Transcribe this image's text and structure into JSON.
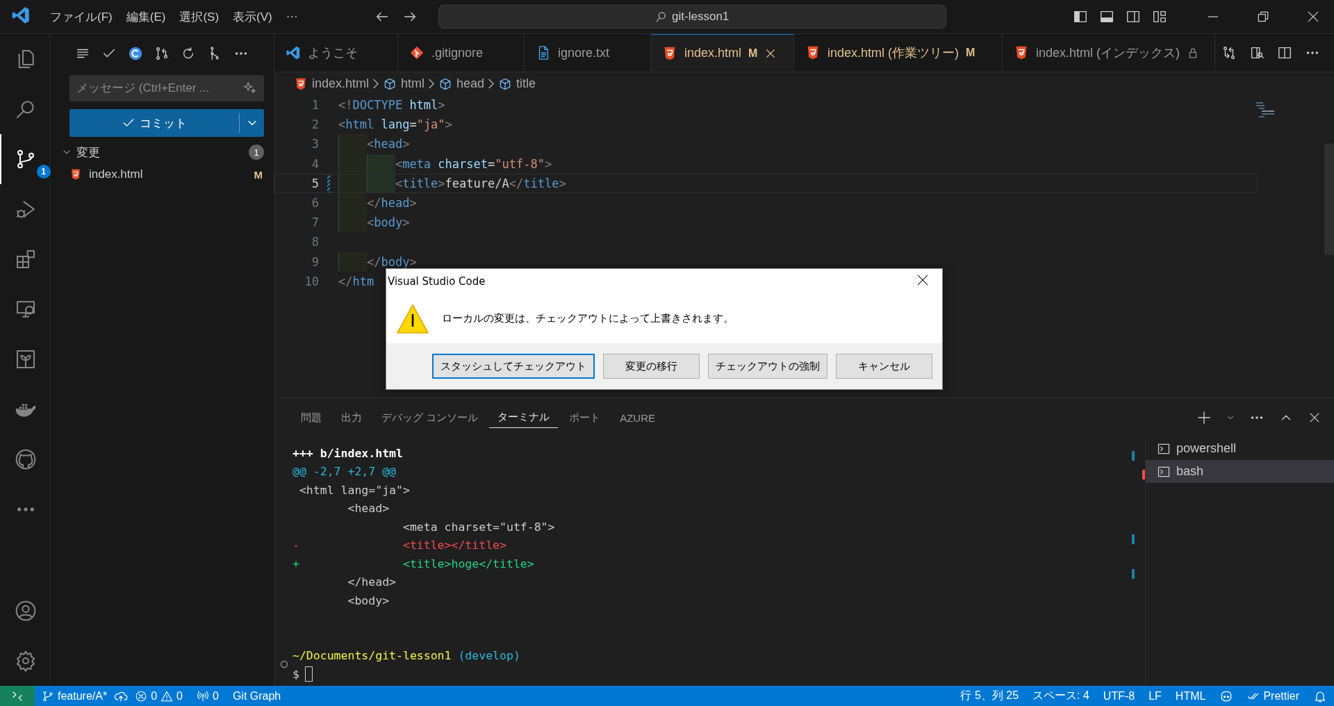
{
  "title_bar": {
    "menus": [
      "ファイル(F)",
      "編集(E)",
      "選択(S)",
      "表示(V)",
      "···"
    ],
    "command_center": "git-lesson1"
  },
  "activity_bar": {
    "items": [
      {
        "selected": false
      },
      {
        "selected": false
      },
      {
        "selected": true,
        "badge": "1"
      },
      {
        "selected": false
      },
      {
        "selected": false
      },
      {
        "selected": false
      },
      {
        "selected": false
      },
      {
        "selected": false
      },
      {
        "selected": false
      },
      {
        "selected": false
      }
    ]
  },
  "sidebar": {
    "message": {
      "placeholder": "メッセージ (Ctrl+Enter ..."
    },
    "commit_button": "コミット",
    "changes": {
      "label": "変更",
      "expanded": true,
      "count": "1",
      "files": [
        {
          "name": "index.html",
          "status": "M"
        }
      ]
    }
  },
  "tabs": [
    {
      "kind": "welcome",
      "label": "ようこそ",
      "selected": false,
      "modified": false
    },
    {
      "kind": "git",
      "label": ".gitignore",
      "selected": false,
      "modified": false
    },
    {
      "kind": "text",
      "label": "ignore.txt",
      "selected": false,
      "modified": false
    },
    {
      "kind": "html",
      "label": "index.html",
      "status": "M",
      "selected": true,
      "modified": true
    },
    {
      "kind": "html",
      "label": "index.html (作業ツリー)",
      "status": "M",
      "selected": false,
      "modified": true
    },
    {
      "kind": "html",
      "label": "index.html (インデックス)",
      "selected": false,
      "modified": false,
      "locked": true
    }
  ],
  "breadcrumbs": [
    {
      "kind": "file",
      "label": "index.html"
    },
    {
      "kind": "element",
      "label": "html"
    },
    {
      "kind": "element",
      "label": "head"
    },
    {
      "kind": "element",
      "label": "title"
    }
  ],
  "editor": {
    "lines": [
      {
        "number": "1",
        "tokens": [
          {
            "kind": "p",
            "text": "<!"
          },
          {
            "kind": "t",
            "text": "DOCTYPE"
          },
          {
            "kind": "a",
            "text": " html"
          },
          {
            "kind": "p",
            "text": ">"
          }
        ]
      },
      {
        "number": "2",
        "tokens": [
          {
            "kind": "p",
            "text": "<"
          },
          {
            "kind": "t",
            "text": "html"
          },
          {
            "kind": "a",
            "text": " lang"
          },
          {
            "kind": "x",
            "text": "="
          },
          {
            "kind": "s",
            "text": "\"ja\""
          },
          {
            "kind": "p",
            "text": ">"
          }
        ]
      },
      {
        "number": "3",
        "tokens": [
          {
            "kind": "p",
            "text": "    <"
          },
          {
            "kind": "t",
            "text": "head"
          },
          {
            "kind": "p",
            "text": ">"
          }
        ]
      },
      {
        "number": "4",
        "tokens": [
          {
            "kind": "p",
            "text": "        <"
          },
          {
            "kind": "t",
            "text": "meta"
          },
          {
            "kind": "a",
            "text": " charset"
          },
          {
            "kind": "x",
            "text": "="
          },
          {
            "kind": "s",
            "text": "\"utf-8\""
          },
          {
            "kind": "p",
            "text": ">"
          }
        ]
      },
      {
        "number": "5",
        "current": true,
        "modified": true,
        "tokens": [
          {
            "kind": "p",
            "text": "        <"
          },
          {
            "kind": "t",
            "text": "title"
          },
          {
            "kind": "p",
            "text": ">"
          },
          {
            "kind": "x",
            "text": "feature/A"
          },
          {
            "kind": "p",
            "text": "</"
          },
          {
            "kind": "t",
            "text": "title"
          },
          {
            "kind": "p",
            "text": ">"
          }
        ]
      },
      {
        "number": "6",
        "tokens": [
          {
            "kind": "p",
            "text": "    </"
          },
          {
            "kind": "t",
            "text": "head"
          },
          {
            "kind": "p",
            "text": ">"
          }
        ]
      },
      {
        "number": "7",
        "tokens": [
          {
            "kind": "p",
            "text": "    <"
          },
          {
            "kind": "t",
            "text": "body"
          },
          {
            "kind": "p",
            "text": ">"
          }
        ]
      },
      {
        "number": "8"
      },
      {
        "number": "9",
        "tokens": [
          {
            "kind": "p",
            "text": "    </"
          },
          {
            "kind": "t",
            "text": "body"
          },
          {
            "kind": "p",
            "text": ">"
          }
        ]
      },
      {
        "number": "10",
        "tokens": [
          {
            "kind": "p",
            "text": "</"
          },
          {
            "kind": "t",
            "text": "htm"
          }
        ]
      }
    ]
  },
  "dialog": {
    "title": "Visual Studio Code",
    "message": "ローカルの変更は、チェックアウトによって上書きされます。",
    "buttons": [
      {
        "label": "スタッシュしてチェックアウト",
        "default": true
      },
      {
        "label": "変更の移行",
        "default": false
      },
      {
        "label": "チェックアウトの強制",
        "default": false
      },
      {
        "label": "キャンセル",
        "default": false
      }
    ]
  },
  "panel": {
    "tabs": [
      {
        "label": "問題",
        "selected": false
      },
      {
        "label": "出力",
        "selected": false
      },
      {
        "label": "デバッグ コンソール",
        "selected": false
      },
      {
        "label": "ターミナル",
        "selected": true
      },
      {
        "label": "ポート",
        "selected": false
      },
      {
        "label": "AZURE",
        "selected": false
      }
    ],
    "terminal": [
      {
        "kind": "header",
        "text": "+++ b/index.html"
      },
      {
        "kind": "hunk",
        "text": "@@ -2,7 +2,7 @@"
      },
      {
        "kind": "context",
        "text": " <html lang=\"ja\">"
      },
      {
        "kind": "context",
        "text": "        <head>"
      },
      {
        "kind": "context",
        "text": "                <meta charset=\"utf-8\">"
      },
      {
        "kind": "removed",
        "text": "-               <title></title>"
      },
      {
        "kind": "added",
        "text": "+               <title>hoge</title>"
      },
      {
        "kind": "context",
        "text": "        </head>"
      },
      {
        "kind": "context",
        "text": "        <body>"
      },
      {
        "kind": "blank"
      },
      {
        "kind": "blank"
      },
      {
        "kind": "path",
        "text": "~/Documents/git-lesson1",
        "branch": "(develop)"
      },
      {
        "kind": "prompt",
        "text": "$"
      }
    ],
    "terminals": [
      {
        "label": "powershell",
        "selected": false
      },
      {
        "label": "bash",
        "selected": true
      }
    ]
  },
  "status_bar": {
    "branch": "feature/A*",
    "errors": "0",
    "warnings": "0",
    "ports": "0",
    "git_graph": "Git Graph",
    "position": "行 5、列 25",
    "spaces": "スペース: 4",
    "encoding": "UTF-8",
    "eol": "LF",
    "language": "HTML",
    "formatter": "Prettier"
  }
}
